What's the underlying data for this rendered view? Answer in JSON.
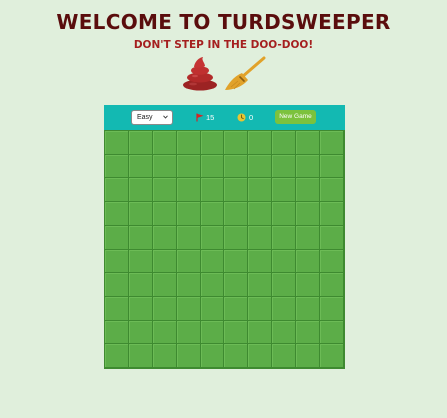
{
  "header": {
    "title": "WELCOME TO TURDSWEEPER",
    "subtitle": "DON'T STEP IN THE DOO-DOO!"
  },
  "decor": {
    "icons": [
      "poop-icon",
      "broom-icon"
    ],
    "poop_color": "#b22a2a",
    "broom_color": "#e1a22a"
  },
  "toolbar": {
    "difficulty": {
      "selected": "Easy"
    },
    "flags": {
      "icon": "flag-icon",
      "count": "15"
    },
    "timer": {
      "icon": "clock-icon",
      "value": "0"
    },
    "new_game_label": "New Game"
  },
  "board": {
    "rows": 10,
    "cols": 10,
    "state": "all-unrevealed"
  },
  "colors": {
    "background": "#e0efdc",
    "header_bar": "#13b9b2",
    "board_green": "#5cad48",
    "button_green": "#7cc23d",
    "title": "#5a0d0d",
    "subtitle": "#a51f1f"
  }
}
